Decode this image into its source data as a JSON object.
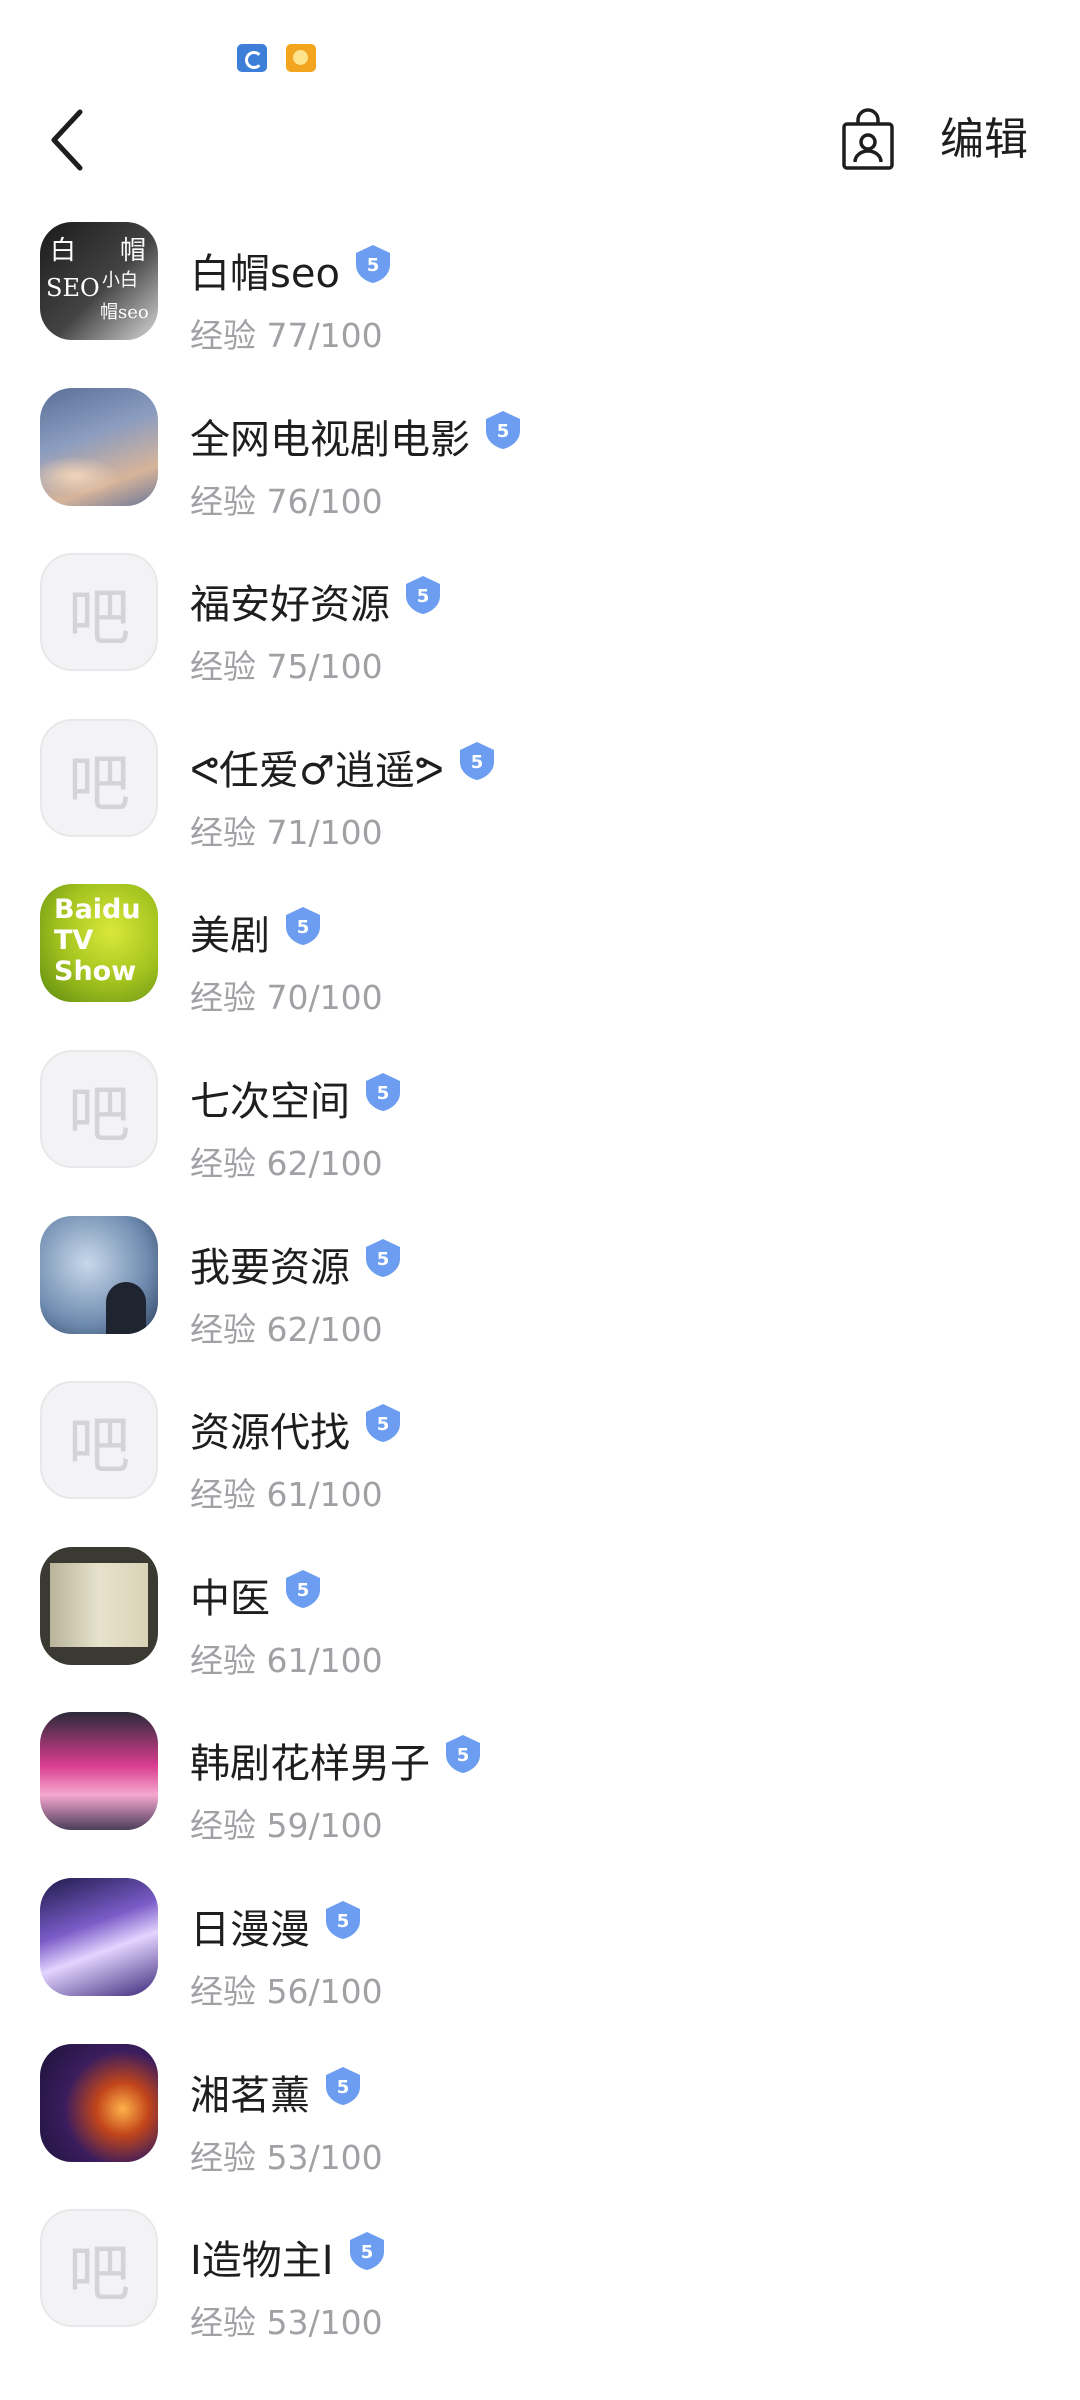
{
  "header": {
    "edit_label": "编辑"
  },
  "icons": {
    "back": "chevron-left-icon",
    "shop": "shop-bag-icon",
    "level_badge": "level-badge-icon"
  },
  "colors": {
    "badge": "#6c9df0",
    "exp_text": "#a0a0a5",
    "name_text": "#1e1e1e"
  },
  "forums": [
    {
      "name": "白帽seo",
      "level": "5",
      "exp_label": "经验",
      "exp": "77/100",
      "avatar": "seo",
      "avatar_text": {
        "t1": "白",
        "t2": "帽",
        "t3": "SEO",
        "t4": "小白",
        "t5": "帽seo"
      }
    },
    {
      "name": "全网电视剧电影",
      "level": "5",
      "exp_label": "经验",
      "exp": "76/100",
      "avatar": "sky"
    },
    {
      "name": "福安好资源",
      "level": "5",
      "exp_label": "经验",
      "exp": "75/100",
      "avatar": "placeholder",
      "placeholder_char": "吧"
    },
    {
      "name": "ᕙ任爱♂逍遥ᕗ",
      "level": "5",
      "exp_label": "经验",
      "exp": "71/100",
      "avatar": "placeholder",
      "placeholder_char": "吧"
    },
    {
      "name": "美剧",
      "level": "5",
      "exp_label": "经验",
      "exp": "70/100",
      "avatar": "baidutv",
      "avatar_text": "Baidu TV Show"
    },
    {
      "name": "七次空间",
      "level": "5",
      "exp_label": "经验",
      "exp": "62/100",
      "avatar": "placeholder",
      "placeholder_char": "吧"
    },
    {
      "name": "我要资源",
      "level": "5",
      "exp_label": "经验",
      "exp": "62/100",
      "avatar": "mind"
    },
    {
      "name": "资源代找",
      "level": "5",
      "exp_label": "经验",
      "exp": "61/100",
      "avatar": "placeholder",
      "placeholder_char": "吧"
    },
    {
      "name": "中医",
      "level": "5",
      "exp_label": "经验",
      "exp": "61/100",
      "avatar": "tcm"
    },
    {
      "name": "韩剧花样男子",
      "level": "5",
      "exp_label": "经验",
      "exp": "59/100",
      "avatar": "kdrama"
    },
    {
      "name": "日漫漫",
      "level": "5",
      "exp_label": "经验",
      "exp": "56/100",
      "avatar": "anime"
    },
    {
      "name": "湘茗薰",
      "level": "5",
      "exp_label": "经验",
      "exp": "53/100",
      "avatar": "lantern"
    },
    {
      "name": "I造物主I",
      "level": "5",
      "exp_label": "经验",
      "exp": "53/100",
      "avatar": "placeholder",
      "placeholder_char": "吧"
    }
  ]
}
